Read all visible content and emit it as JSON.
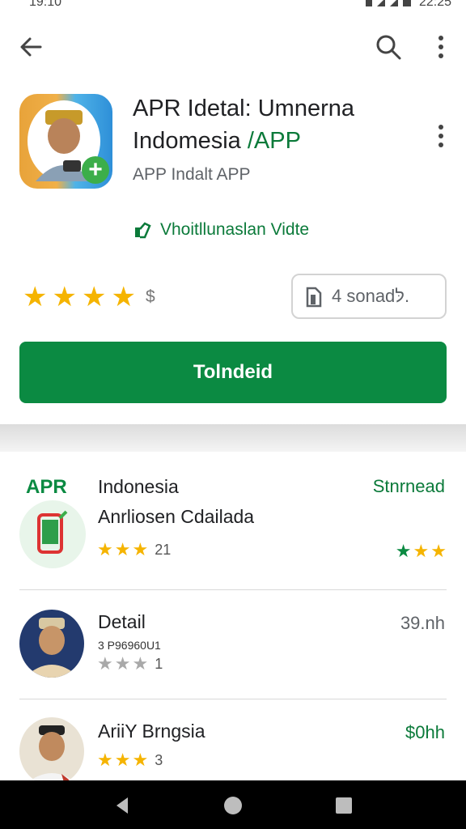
{
  "status_bar": {
    "time": "19:10",
    "clock_right": "22:25"
  },
  "app": {
    "title_line1": "APR Idetal: Umnerna",
    "title_line2_main": "Indomesia ",
    "title_line2_accent": "/APP",
    "developer": "APP Indalt APP",
    "verified_label": "Vhoitllunaslan Vidte",
    "rating_suffix": "$",
    "size_label": "4 sonadלּ.",
    "install_label": "Tolndeid"
  },
  "list": [
    {
      "tag": "APR",
      "title": "Indonesia",
      "subtitle": "Anrliosen Cdailada",
      "count": "21",
      "right_label": "Stnrnead"
    },
    {
      "title": "Detail",
      "meta": "3 P96960U1",
      "count": "1",
      "right_label": "39.nh"
    },
    {
      "title": "AriiY Brngsia",
      "count": "3",
      "right_label": "$0hh"
    }
  ],
  "icons": {
    "back": "arrow-back-icon",
    "search": "search-icon",
    "more": "more-vert-icon",
    "verified": "shield-check-icon",
    "size": "document-icon"
  },
  "colors": {
    "accent_green": "#0b8a42",
    "star_gold": "#f5b400",
    "star_grey": "#a9a9a9"
  }
}
